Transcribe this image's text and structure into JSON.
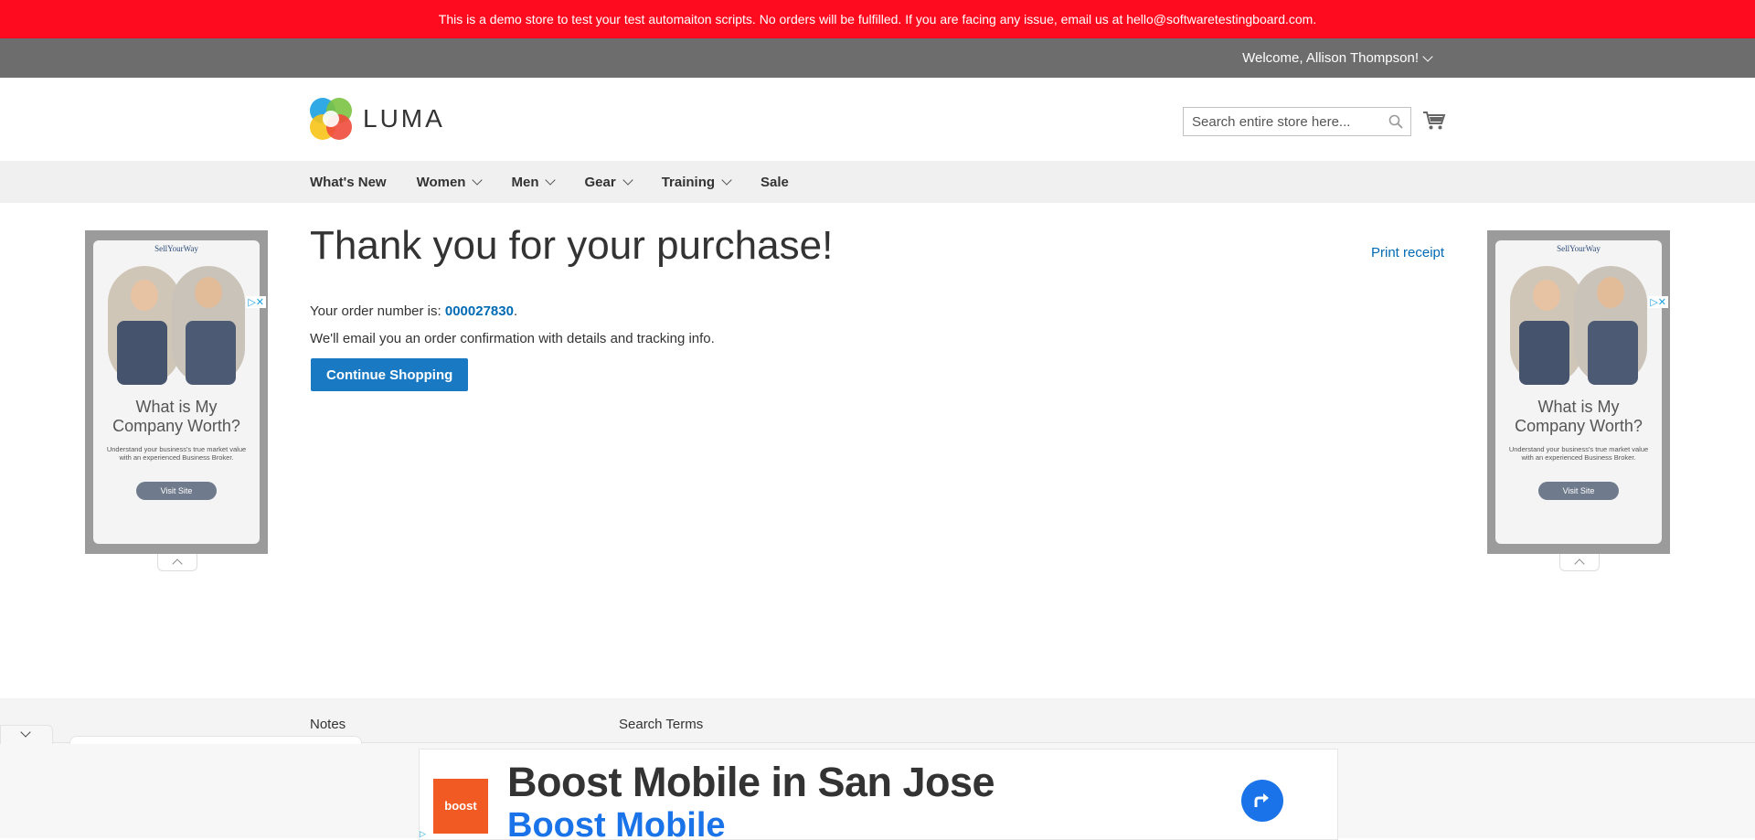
{
  "demo_notice": "This is a demo store to test your test automaiton scripts. No orders will be fulfilled. If you are facing any issue, email us at hello@softwaretestingboard.com.",
  "header": {
    "welcome": "Welcome, Allison Thompson!",
    "logo_text": "LUMA",
    "search_placeholder": "Search entire store here...",
    "icons": {
      "search": "search-icon",
      "cart": "cart-icon",
      "logo": "luma-logo-icon"
    }
  },
  "nav": {
    "items": [
      {
        "label": "What's New",
        "has_dropdown": false
      },
      {
        "label": "Women",
        "has_dropdown": true
      },
      {
        "label": "Men",
        "has_dropdown": true
      },
      {
        "label": "Gear",
        "has_dropdown": true
      },
      {
        "label": "Training",
        "has_dropdown": true
      },
      {
        "label": "Sale",
        "has_dropdown": false
      }
    ]
  },
  "main": {
    "title": "Thank you for your purchase!",
    "print_receipt": "Print receipt",
    "order_prefix": "Your order number is: ",
    "order_number": "000027830",
    "order_suffix": ".",
    "email_message": "We'll email you an order confirmation with details and tracking info.",
    "continue_button": "Continue Shopping"
  },
  "side_ads": {
    "brand": "SellYourWay",
    "headline_line1": "What is My",
    "headline_line2": "Company Worth?",
    "subtext": "Understand your business's true market value with an experienced Business Broker.",
    "button": "Visit Site",
    "choices_icons": "▷✕"
  },
  "footer": {
    "links": [
      "Notes",
      "Search Terms"
    ]
  },
  "bottom_ad": {
    "logo_text": "boost",
    "headline": "Boost Mobile in San Jose",
    "subheadline": "Boost Mobile"
  },
  "colors": {
    "demo_bar": "#ff0b1f",
    "panel": "#6d6d6d",
    "nav_bg": "#f0f0f0",
    "primary": "#1979c3",
    "link": "#006bb4"
  }
}
